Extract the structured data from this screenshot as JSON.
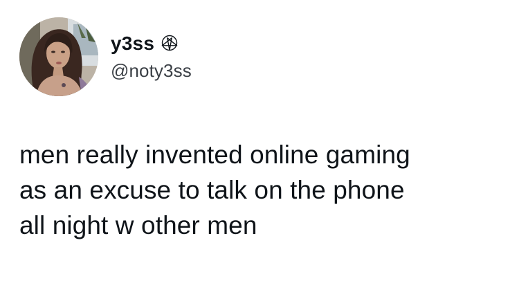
{
  "author": {
    "display_name": "y3ss",
    "handle": "@noty3ss",
    "badge_icon": "pentagram-icon",
    "avatar_alt": "profile photo"
  },
  "tweet": {
    "lines": [
      "men really invented online gaming",
      "as an excuse to talk on the phone",
      "all night w other men"
    ]
  },
  "colors": {
    "background": "#ffffff",
    "text": "#0f1419",
    "handle": "#3b4046"
  }
}
